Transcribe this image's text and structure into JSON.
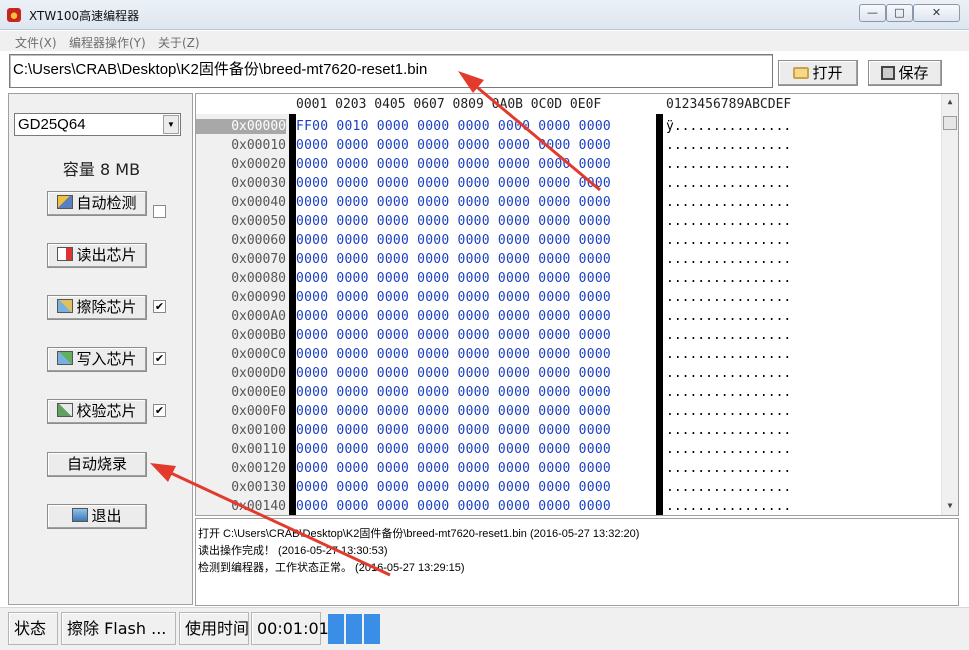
{
  "window": {
    "title": "XTW100高速编程器",
    "controls": [
      "minimize-icon",
      "maximize-icon",
      "close-icon"
    ]
  },
  "menu": {
    "items": [
      {
        "label": "文件(X)"
      },
      {
        "label": "编程器操作(Y)"
      },
      {
        "label": "关于(Z)"
      }
    ]
  },
  "path": {
    "value": "C:\\Users\\CRAB\\Desktop\\K2固件备份\\breed-mt7620-reset1.bin"
  },
  "toolbar": {
    "open_label": "打开",
    "save_label": "保存"
  },
  "left_panel": {
    "chip_model": "GD25Q64",
    "capacity": "容量 8 MB",
    "buttons": [
      {
        "label": "自动检测",
        "icon": "detect-icon",
        "checkbox": false
      },
      {
        "label": "读出芯片",
        "icon": "read-icon",
        "checkbox": null
      },
      {
        "label": "擦除芯片",
        "icon": "erase-icon",
        "checkbox": true
      },
      {
        "label": "写入芯片",
        "icon": "write-icon",
        "checkbox": true
      },
      {
        "label": "校验芯片",
        "icon": "verify-icon",
        "checkbox": true
      },
      {
        "label": "自动烧录",
        "icon": null,
        "checkbox": null
      },
      {
        "label": "退出",
        "icon": "exit-icon",
        "checkbox": null
      }
    ]
  },
  "hex": {
    "header_bytes": "0001 0203 0405 0607 0809 0A0B 0C0D 0E0F",
    "header_ascii": "0123456789ABCDEF",
    "rows": [
      {
        "addr": "0x00000",
        "bytes": "FF00 0010 0000 0000 0000 0000 0000 0000",
        "ascii": "ÿ..............."
      },
      {
        "addr": "0x00010",
        "bytes": "0000 0000 0000 0000 0000 0000 0000 0000",
        "ascii": "................"
      },
      {
        "addr": "0x00020",
        "bytes": "0000 0000 0000 0000 0000 0000 0000 0000",
        "ascii": "................"
      },
      {
        "addr": "0x00030",
        "bytes": "0000 0000 0000 0000 0000 0000 0000 0000",
        "ascii": "................"
      },
      {
        "addr": "0x00040",
        "bytes": "0000 0000 0000 0000 0000 0000 0000 0000",
        "ascii": "................"
      },
      {
        "addr": "0x00050",
        "bytes": "0000 0000 0000 0000 0000 0000 0000 0000",
        "ascii": "................"
      },
      {
        "addr": "0x00060",
        "bytes": "0000 0000 0000 0000 0000 0000 0000 0000",
        "ascii": "................"
      },
      {
        "addr": "0x00070",
        "bytes": "0000 0000 0000 0000 0000 0000 0000 0000",
        "ascii": "................"
      },
      {
        "addr": "0x00080",
        "bytes": "0000 0000 0000 0000 0000 0000 0000 0000",
        "ascii": "................"
      },
      {
        "addr": "0x00090",
        "bytes": "0000 0000 0000 0000 0000 0000 0000 0000",
        "ascii": "................"
      },
      {
        "addr": "0x000A0",
        "bytes": "0000 0000 0000 0000 0000 0000 0000 0000",
        "ascii": "................"
      },
      {
        "addr": "0x000B0",
        "bytes": "0000 0000 0000 0000 0000 0000 0000 0000",
        "ascii": "................"
      },
      {
        "addr": "0x000C0",
        "bytes": "0000 0000 0000 0000 0000 0000 0000 0000",
        "ascii": "................"
      },
      {
        "addr": "0x000D0",
        "bytes": "0000 0000 0000 0000 0000 0000 0000 0000",
        "ascii": "................"
      },
      {
        "addr": "0x000E0",
        "bytes": "0000 0000 0000 0000 0000 0000 0000 0000",
        "ascii": "................"
      },
      {
        "addr": "0x000F0",
        "bytes": "0000 0000 0000 0000 0000 0000 0000 0000",
        "ascii": "................"
      },
      {
        "addr": "0x00100",
        "bytes": "0000 0000 0000 0000 0000 0000 0000 0000",
        "ascii": "................"
      },
      {
        "addr": "0x00110",
        "bytes": "0000 0000 0000 0000 0000 0000 0000 0000",
        "ascii": "................"
      },
      {
        "addr": "0x00120",
        "bytes": "0000 0000 0000 0000 0000 0000 0000 0000",
        "ascii": "................"
      },
      {
        "addr": "0x00130",
        "bytes": "0000 0000 0000 0000 0000 0000 0000 0000",
        "ascii": "................"
      },
      {
        "addr": "0x00140",
        "bytes": "0000 0000 0000 0000 0000 0000 0000 0000",
        "ascii": "................"
      }
    ]
  },
  "log": {
    "lines": [
      "打开 C:\\Users\\CRAB\\Desktop\\K2固件备份\\breed-mt7620-reset1.bin (2016-05-27 13:32:20)",
      "读出操作完成！ (2016-05-27 13:30:53)",
      "检测到编程器，工作状态正常。 (2016-05-27 13:29:15)"
    ]
  },
  "status": {
    "state_label": "状态",
    "state_value": "擦除 Flash ...",
    "time_label": "使用时间",
    "time_value": "00:01:01",
    "progress_segments": 3
  },
  "colors": {
    "hex_bytes": "#1a3fc4",
    "annotation_arrow": "#e23b2e",
    "progress": "#3a8ee6"
  }
}
